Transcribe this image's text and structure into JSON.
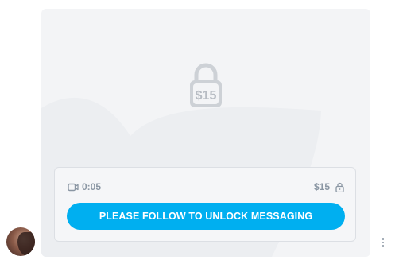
{
  "post": {
    "lock_price": "$15",
    "video_duration": "0:05",
    "price": "$15",
    "unlock_button_label": "PLEASE FOLLOW TO UNLOCK MESSAGING"
  },
  "icons": {
    "media_type": "video-icon",
    "price_lock": "lock-icon",
    "center_lock": "lock-icon",
    "more_options": "more-vertical-icon"
  },
  "colors": {
    "accent": "#00aff0",
    "card_background": "#f3f4f6",
    "muted_text": "#8a96a3",
    "lock_gray": "#c8ccd2"
  }
}
